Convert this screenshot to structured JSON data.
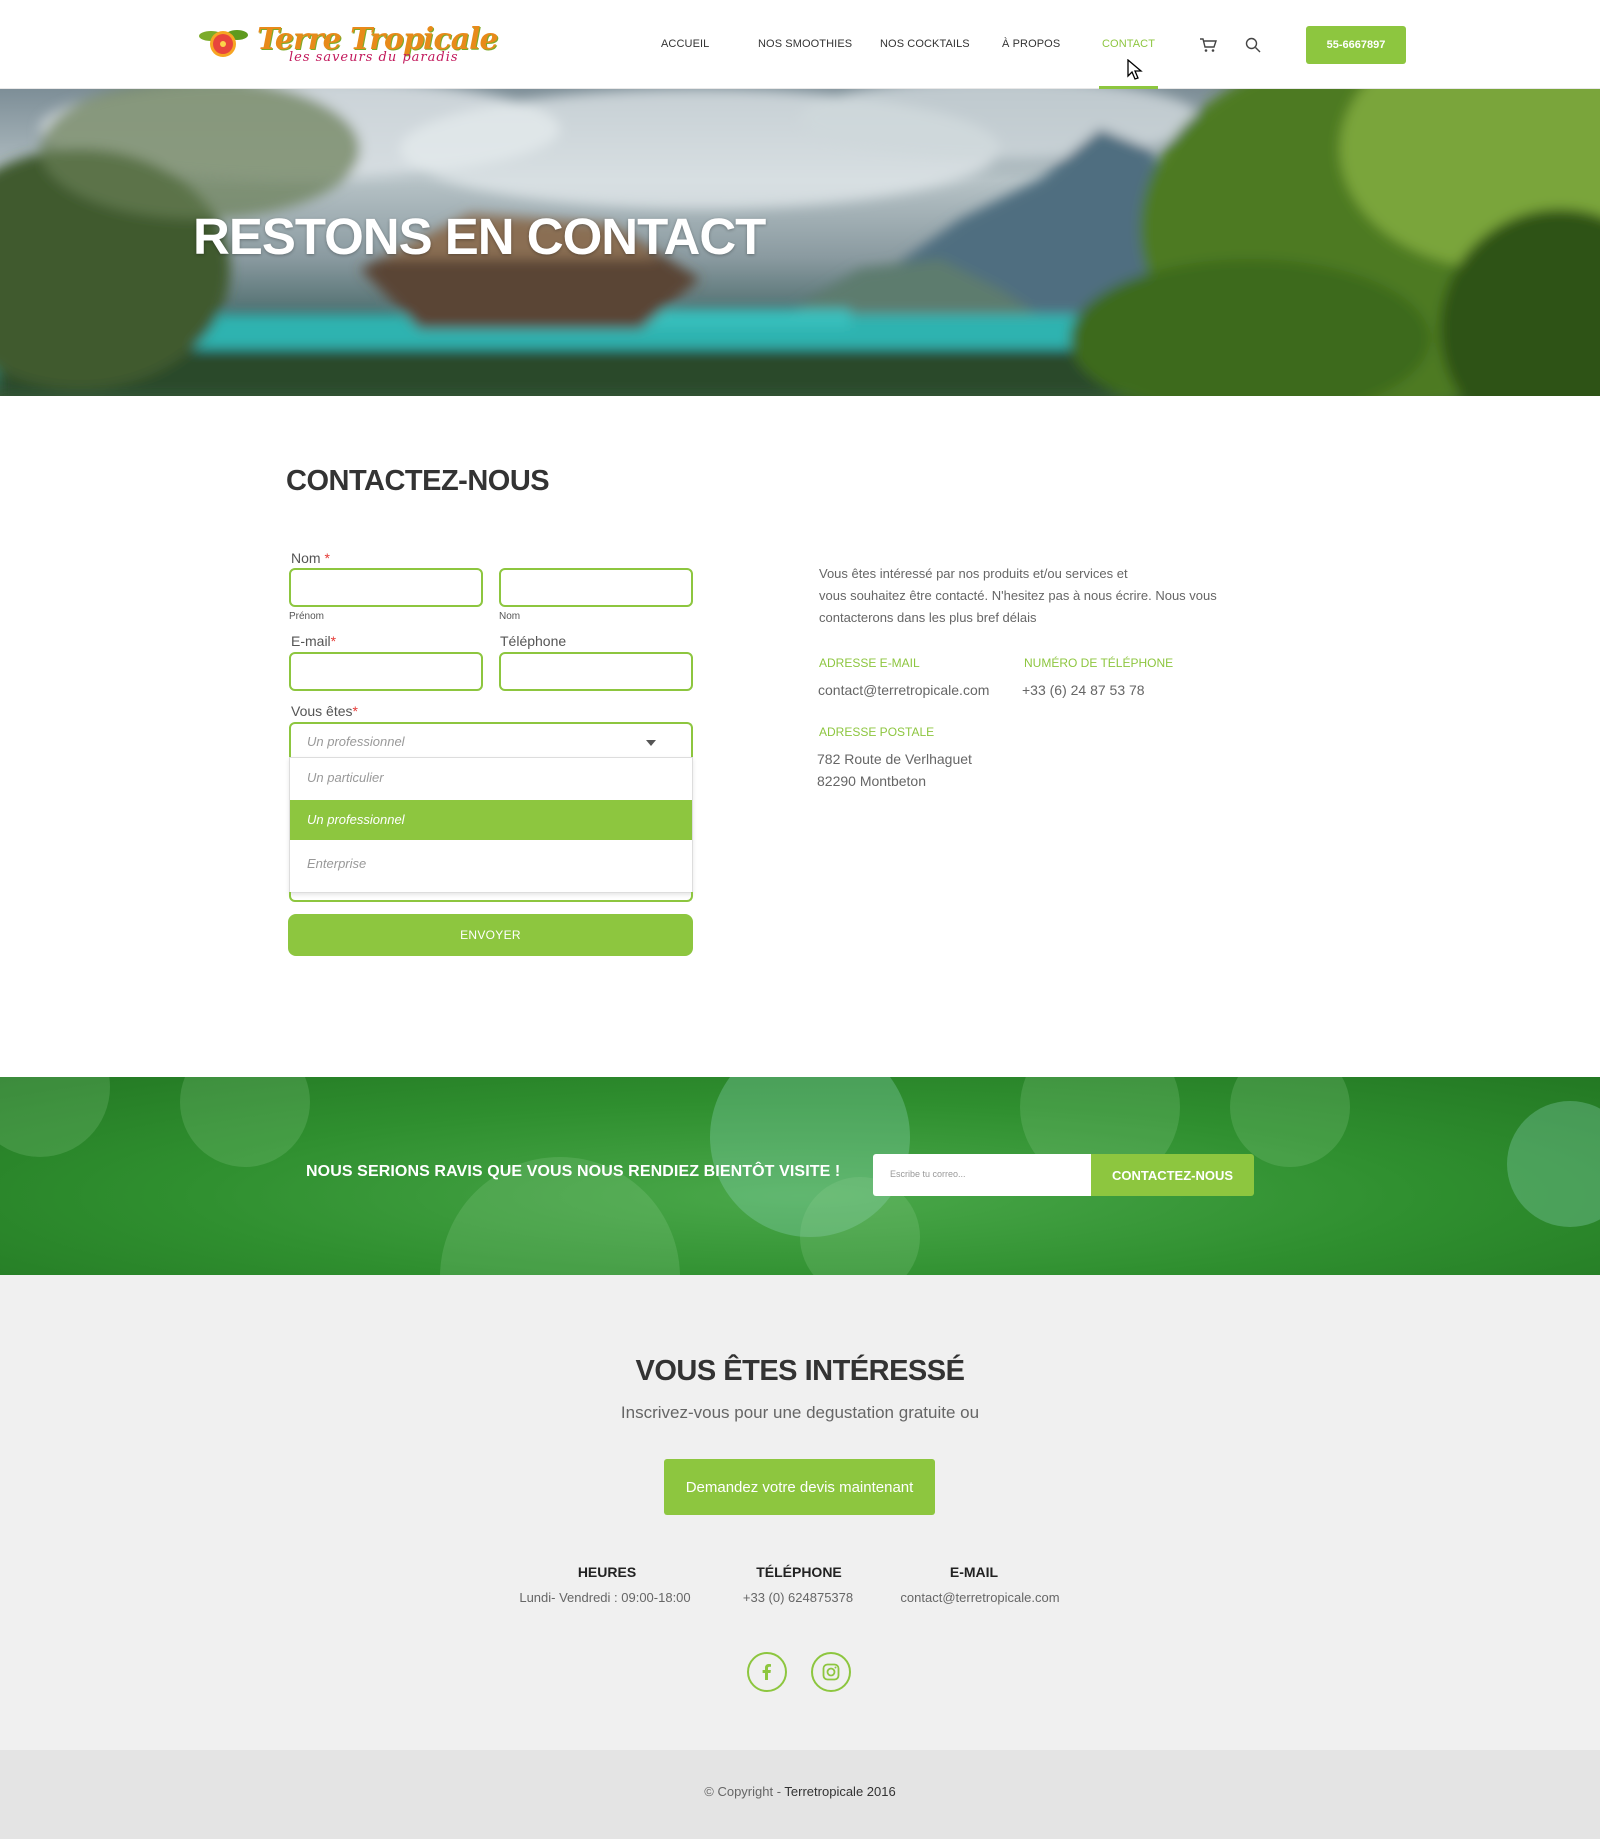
{
  "header": {
    "logo_title": "Terre Tropicale",
    "logo_subtitle": "les saveurs du paradis",
    "nav": {
      "home": "ACCUEIL",
      "smoothies": "NOS SMOOTHIES",
      "cocktails": "NOS COCKTAILS",
      "about": "À PROPOS",
      "contact": "CONTACT"
    },
    "phone_button": "55-6667897",
    "icons": [
      "cart-icon",
      "search-icon"
    ]
  },
  "hero": {
    "title": "RESTONS EN CONTACT"
  },
  "contact": {
    "title": "CONTACTEZ-NOUS",
    "form": {
      "name_label": "Nom",
      "required_mark": "*",
      "first_name_sublabel": "Prénom",
      "last_name_sublabel": "Nom",
      "email_label": "E-mail",
      "phone_label": "Téléphone",
      "type_label": "Vous êtes",
      "type_selected": "Un professionnel",
      "type_options": [
        "Un particulier",
        "Un professionnel",
        "Enterprise"
      ],
      "submit": "ENVOYER"
    },
    "info": {
      "intro_line1": "Vous êtes intéressé par nos produits et/ou services et",
      "intro_line2": "vous souhaitez être contacté. N'hesitez pas à nous écrire.  Nous vous",
      "intro_line3": "contacterons dans les plus bref délais",
      "email_heading": "ADRESSE E-MAIL",
      "email_value": "contact@terretropicale.com",
      "phone_heading": "NUMÉRO DE TÉLÉPHONE",
      "phone_value": "+33 (6) 24 87 53 78",
      "postal_heading": "ADRESSE POSTALE",
      "postal_line1": "782 Route de Verlhaguet",
      "postal_line2": "82290 Montbeton"
    }
  },
  "band": {
    "text": "NOUS SERIONS RAVIS QUE VOUS NOUS RENDIEZ BIENTÔT VISITE !",
    "email_placeholder": "Escribe tu correo...",
    "button": "CONTACTEZ-NOUS"
  },
  "interest": {
    "title": "VOUS ÊTES INTÉRESSÉ",
    "subtitle": "Inscrivez-vous pour une degustation gratuite ou",
    "button": "Demandez votre devis maintenant",
    "hours_heading": "HEURES",
    "hours_value": "Lundi- Vendredi : 09:00-18:00",
    "phone_heading": "TÉLÉPHONE",
    "phone_value": "+33 (0) 624875378",
    "email_heading": "E-MAIL",
    "email_value": "contact@terretropicale.com",
    "social": [
      "facebook-icon",
      "instagram-icon"
    ]
  },
  "footer": {
    "copyright_prefix": "© Copyright - ",
    "copyright_brand": "Terretropicale 2016"
  },
  "colors": {
    "accent": "#8dc63f",
    "band_green": "#2f8f2f",
    "required": "#e53935"
  }
}
